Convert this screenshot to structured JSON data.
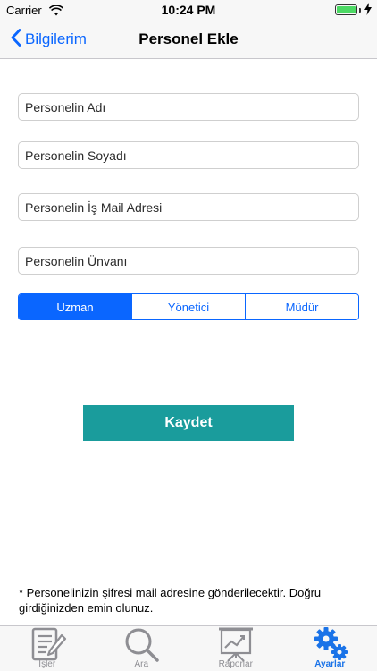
{
  "status_bar": {
    "carrier": "Carrier",
    "time": "10:24 PM",
    "battery_level": 1.0
  },
  "nav": {
    "back_label": "Bilgilerim",
    "title": "Personel Ekle"
  },
  "form": {
    "name_placeholder": "Personelin Adı",
    "surname_placeholder": "Personelin Soyadı",
    "email_placeholder": "Personelin İş Mail Adresi",
    "title_placeholder": "Personelin Ünvanı"
  },
  "role_selector": {
    "options": [
      "Uzman",
      "Yönetici",
      "Müdür"
    ],
    "selected": "Uzman"
  },
  "save_label": "Kaydet",
  "footnote": "* Personelinizin şifresi mail adresine gönderilecektir. Doğru girdiğinizden emin olunuz.",
  "tabs": [
    {
      "label": "İşler",
      "icon": "tasks-icon"
    },
    {
      "label": "Ara",
      "icon": "search-icon"
    },
    {
      "label": "Raporlar",
      "icon": "reports-icon"
    },
    {
      "label": "Ayarlar",
      "icon": "settings-icon"
    }
  ],
  "active_tab": "Ayarlar",
  "colors": {
    "accent": "#0a66ff",
    "button": "#1a9c9c",
    "active_tab": "#1a73e8"
  }
}
